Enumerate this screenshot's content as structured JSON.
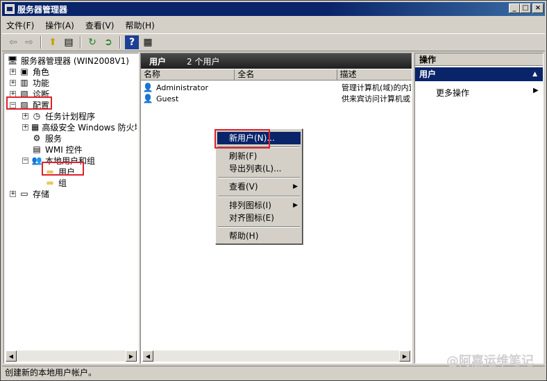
{
  "window": {
    "title": "服务器管理器",
    "min": "_",
    "max": "□",
    "close": "×"
  },
  "menu": [
    "文件(F)",
    "操作(A)",
    "查看(V)",
    "帮助(H)"
  ],
  "tree": {
    "root": "服务器管理器 (WIN2008V1)",
    "items": [
      "角色",
      "功能",
      "诊断",
      "配置",
      "任务计划程序",
      "高级安全 Windows 防火墙",
      "服务",
      "WMI 控件",
      "本地用户和组",
      "用户",
      "组",
      "存储"
    ]
  },
  "list": {
    "header_title": "用户",
    "header_count": "2 个用户",
    "columns": [
      "名称",
      "全名",
      "描述"
    ],
    "rows": [
      {
        "name": "Administrator",
        "desc": "管理计算机(域)的内置帐户"
      },
      {
        "name": "Guest",
        "desc": "供来宾访问计算机或访问域的内置帐户"
      }
    ]
  },
  "actions": {
    "title": "操作",
    "section": "用户",
    "item": "更多操作"
  },
  "context_menu": [
    "新用户(N)...",
    "刷新(F)",
    "导出列表(L)...",
    "查看(V)",
    "排列图标(I)",
    "对齐图标(E)",
    "帮助(H)"
  ],
  "status": "创建新的本地用户帐户。",
  "watermark": "@阿嘉运维笔记",
  "colors": {
    "title": "#0a246a",
    "highlight": "#0a246a",
    "redbox": "#e0202a"
  }
}
